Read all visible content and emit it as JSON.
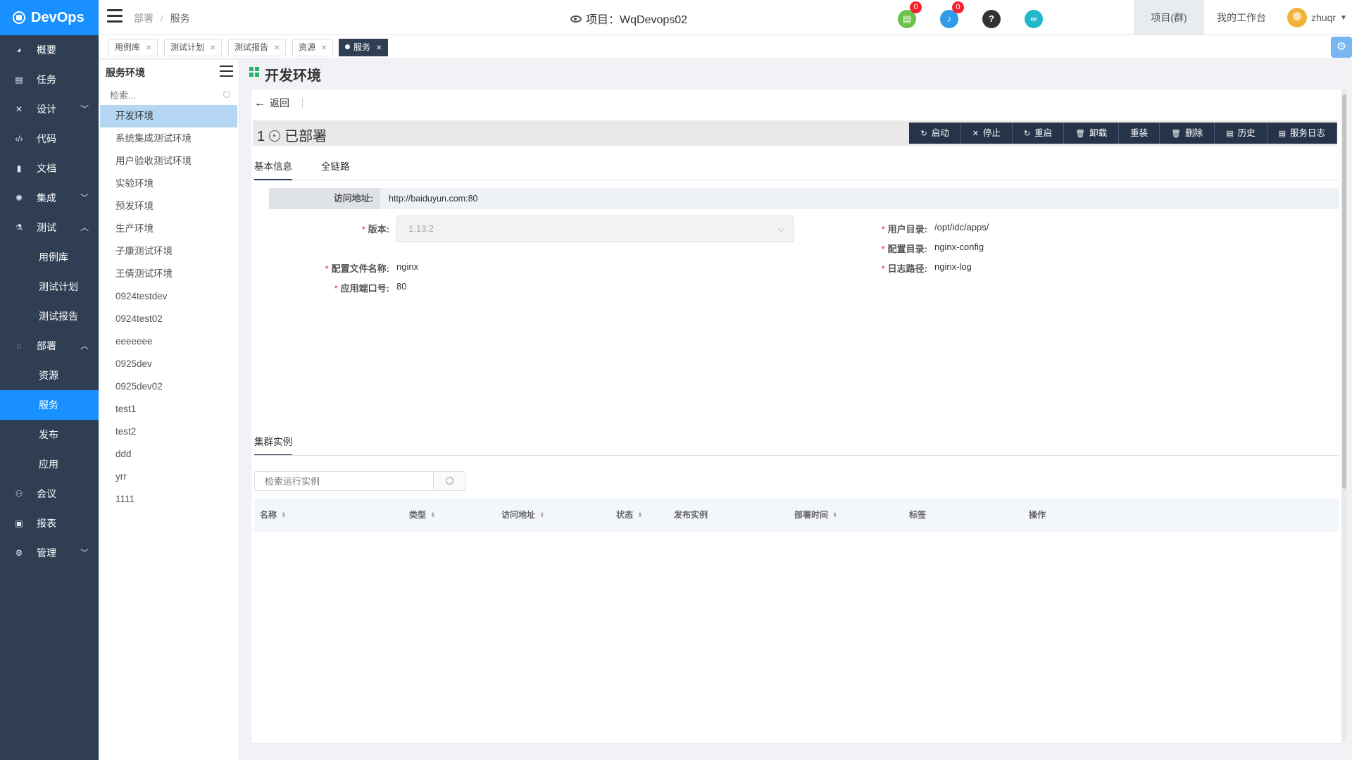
{
  "app": {
    "name": "DevOps"
  },
  "sidebar": {
    "items": [
      {
        "label": "概要",
        "icon": "dashboard-icon"
      },
      {
        "label": "任务",
        "icon": "task-icon"
      },
      {
        "label": "设计",
        "icon": "design-icon",
        "expandable": true
      },
      {
        "label": "代码",
        "icon": "code-icon"
      },
      {
        "label": "文档",
        "icon": "document-icon"
      },
      {
        "label": "集成",
        "icon": "integration-icon",
        "expandable": true
      },
      {
        "label": "测试",
        "icon": "test-icon",
        "expanded": true
      },
      {
        "label": "用例库",
        "sub": true
      },
      {
        "label": "测试计划",
        "sub": true
      },
      {
        "label": "测试报告",
        "sub": true
      },
      {
        "label": "部署",
        "icon": "deploy-icon",
        "expanded": true
      },
      {
        "label": "资源",
        "sub": true
      },
      {
        "label": "服务",
        "sub": true,
        "active": true
      },
      {
        "label": "发布",
        "sub": true
      },
      {
        "label": "应用",
        "sub": true
      },
      {
        "label": "会议",
        "icon": "meeting-icon"
      },
      {
        "label": "报表",
        "icon": "report-icon"
      },
      {
        "label": "管理",
        "icon": "settings-icon",
        "expandable": true
      }
    ]
  },
  "header": {
    "breadcrumb": [
      "部署",
      "服务"
    ],
    "project_label": "项目：",
    "project_name": "WqDevops02",
    "task_badge": "0",
    "notify_badge": "0",
    "project_group": "项目(群)",
    "workbench": "我的工作台",
    "username": "zhuqr"
  },
  "tabs": [
    {
      "label": "用例库"
    },
    {
      "label": "测试计划"
    },
    {
      "label": "测试报告"
    },
    {
      "label": "资源"
    },
    {
      "label": "服务",
      "active": true
    }
  ],
  "env_panel": {
    "title": "服务环境",
    "search_placeholder": "检索...",
    "items": [
      "开发环境",
      "系统集成测试环境",
      "用户验收测试环境",
      "实验环境",
      "预发环境",
      "生产环境",
      "子康测试环境",
      "王倩测试环境",
      "0924testdev",
      "0924test02",
      "eeeeeee",
      "0925dev",
      "0925dev02",
      "test1",
      "test2",
      "ddd",
      "yrr",
      "1111"
    ],
    "active_index": 0
  },
  "main": {
    "title": "开发环境",
    "back": "返回",
    "instance_count": "1",
    "status": "已部署",
    "actions": [
      {
        "label": "启动",
        "glyph": "↻"
      },
      {
        "label": "停止",
        "glyph": "✕"
      },
      {
        "label": "重启",
        "glyph": "↻"
      },
      {
        "label": "卸载",
        "glyph": "🗑"
      },
      {
        "label": "重装",
        "glyph": ""
      },
      {
        "label": "删除",
        "glyph": "🗑"
      },
      {
        "label": "历史",
        "glyph": "▤"
      },
      {
        "label": "服务日志",
        "glyph": "▤"
      }
    ],
    "info_tabs": [
      "基本信息",
      "全链路"
    ],
    "access_label": "访问地址:",
    "access_url": "http://baiduyun.com:80",
    "fields": {
      "version_label": "版本:",
      "version_value": "1.13.2",
      "config_file_label": "配置文件名称:",
      "config_file_value": "nginx",
      "port_label": "应用端口号:",
      "port_value": "80",
      "user_dir_label": "用户目录:",
      "user_dir_value": "/opt/idc/apps/",
      "config_dir_label": "配置目录:",
      "config_dir_value": "nginx-config",
      "log_path_label": "日志路径:",
      "log_path_value": "nginx-log"
    },
    "cluster_title": "集群实例",
    "instance_search_placeholder": "检索运行实例",
    "table_headers": [
      "名称",
      "类型",
      "访问地址",
      "状态",
      "发布实例",
      "部署时间",
      "标签",
      "操作"
    ]
  }
}
